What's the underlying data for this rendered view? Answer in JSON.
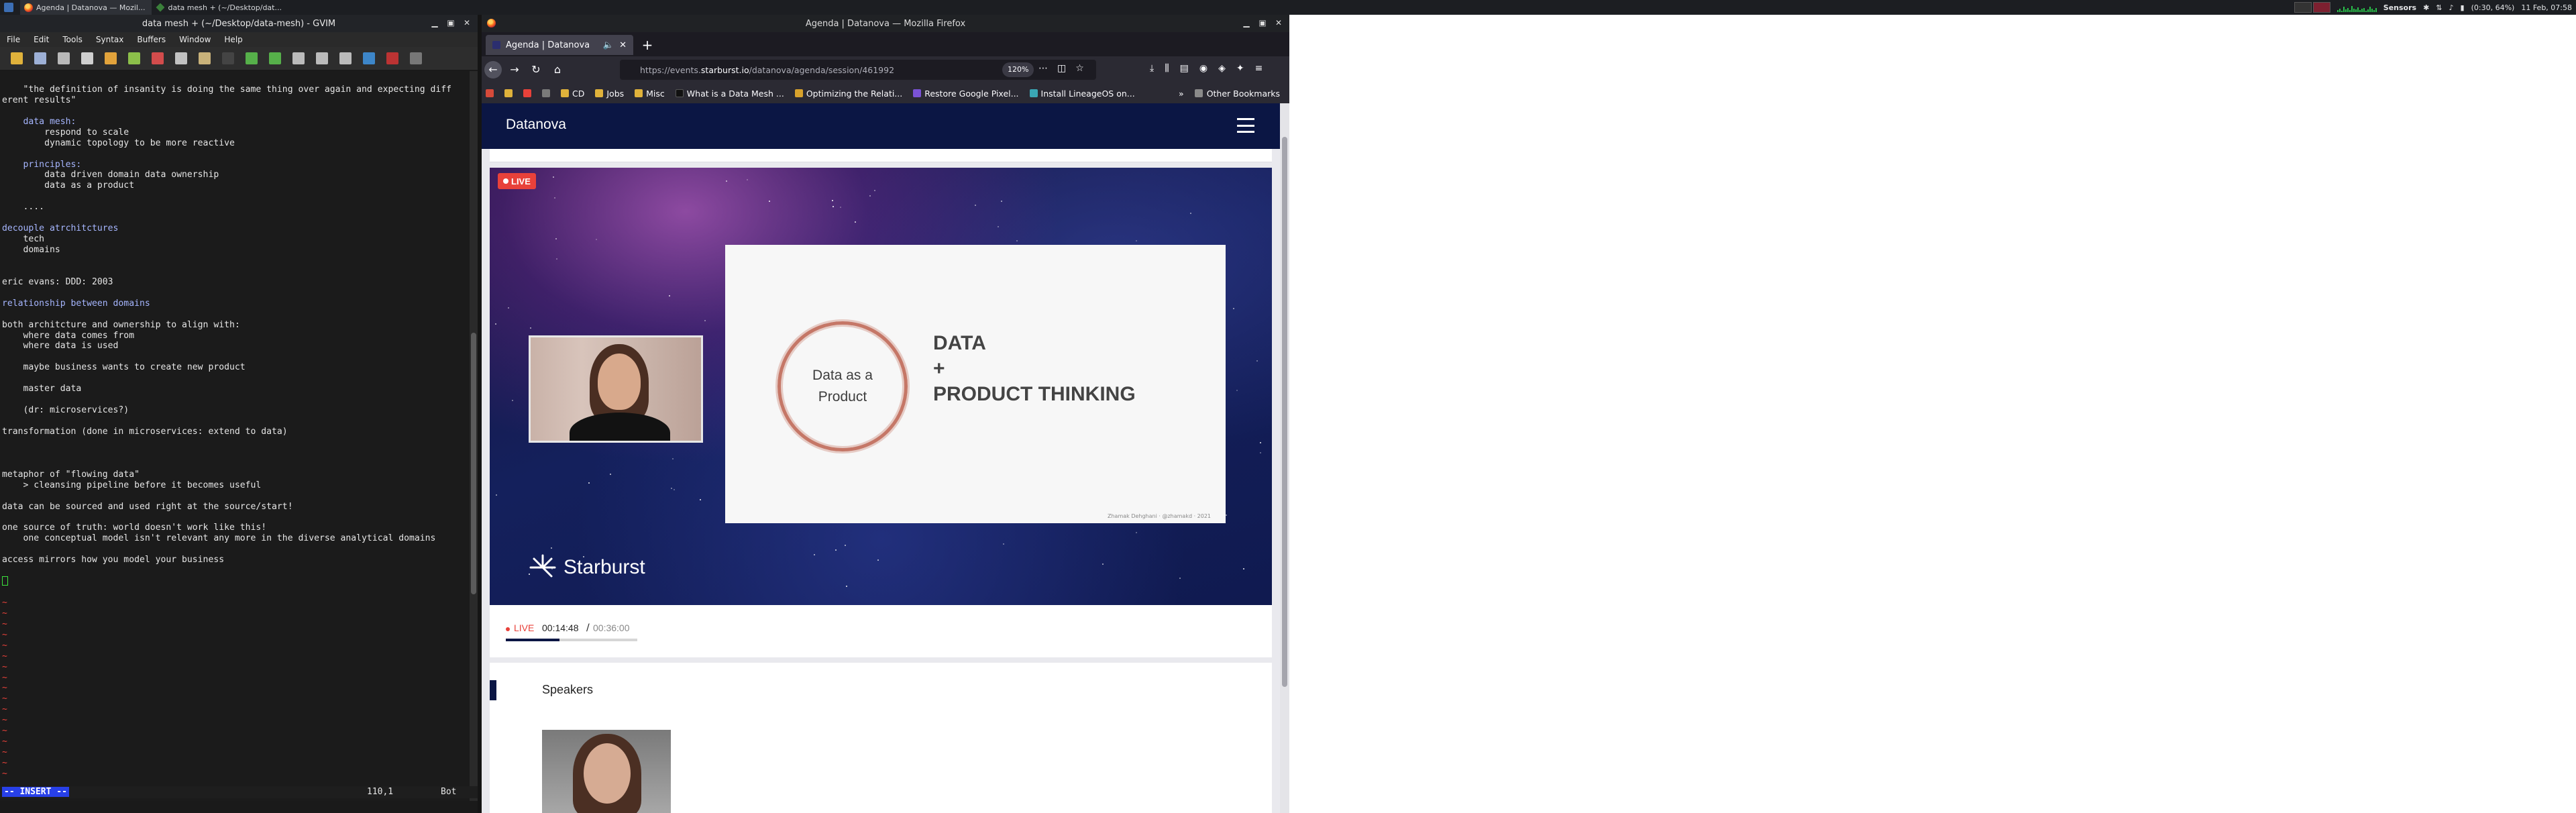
{
  "panel": {
    "tasks": [
      {
        "label": "Agenda | Datanova — Mozil..."
      },
      {
        "label": "data mesh + (~/Desktop/dat..."
      }
    ],
    "tray": {
      "sensors": "Sensors",
      "battery": "(0:30, 64%)",
      "clock": "11 Feb, 07:58"
    }
  },
  "gvim": {
    "title": "data mesh + (~/Desktop/data-mesh) - GVIM",
    "menu": [
      "File",
      "Edit",
      "Tools",
      "Syntax",
      "Buffers",
      "Window",
      "Help"
    ],
    "lines": [
      {
        "t": "",
        "c": ""
      },
      {
        "t": "    \"the definition of insanity is doing the same thing over again and expecting diff",
        "c": ""
      },
      {
        "t": "erent results\"",
        "c": ""
      },
      {
        "t": "",
        "c": ""
      },
      {
        "t": "    data mesh:",
        "c": "blue"
      },
      {
        "t": "        respond to scale",
        "c": ""
      },
      {
        "t": "        dynamic topology to be more reactive",
        "c": ""
      },
      {
        "t": "",
        "c": ""
      },
      {
        "t": "    principles:",
        "c": "blue"
      },
      {
        "t": "        data driven domain data ownership",
        "c": ""
      },
      {
        "t": "        data as a product",
        "c": ""
      },
      {
        "t": "",
        "c": ""
      },
      {
        "t": "    ....",
        "c": ""
      },
      {
        "t": "",
        "c": ""
      },
      {
        "t": "decouple atrchitctures",
        "c": "blue"
      },
      {
        "t": "    tech",
        "c": ""
      },
      {
        "t": "    domains",
        "c": ""
      },
      {
        "t": "",
        "c": ""
      },
      {
        "t": "",
        "c": ""
      },
      {
        "t": "eric evans: DDD: 2003",
        "c": ""
      },
      {
        "t": "",
        "c": ""
      },
      {
        "t": "relationship between domains",
        "c": "blue"
      },
      {
        "t": "",
        "c": ""
      },
      {
        "t": "both architcture and ownership to align with:",
        "c": ""
      },
      {
        "t": "    where data comes from",
        "c": ""
      },
      {
        "t": "    where data is used",
        "c": ""
      },
      {
        "t": "",
        "c": ""
      },
      {
        "t": "    maybe business wants to create new product",
        "c": ""
      },
      {
        "t": "",
        "c": ""
      },
      {
        "t": "    master data",
        "c": ""
      },
      {
        "t": "",
        "c": ""
      },
      {
        "t": "    (dr: microservices?)",
        "c": ""
      },
      {
        "t": "",
        "c": ""
      },
      {
        "t": "transformation (done in microservices: extend to data)",
        "c": ""
      },
      {
        "t": "",
        "c": ""
      },
      {
        "t": "",
        "c": ""
      },
      {
        "t": "",
        "c": ""
      },
      {
        "t": "metaphor of \"flowing data\"",
        "c": ""
      },
      {
        "t": "    > cleansing pipeline before it becomes useful",
        "c": ""
      },
      {
        "t": "",
        "c": ""
      },
      {
        "t": "data can be sourced and used right at the source/start!",
        "c": ""
      },
      {
        "t": "",
        "c": ""
      },
      {
        "t": "one source of truth: world doesn't work like this!",
        "c": ""
      },
      {
        "t": "    one conceptual model isn't relevant any more in the diverse analytical domains",
        "c": ""
      },
      {
        "t": "",
        "c": ""
      },
      {
        "t": "access mirrors how you model your business",
        "c": ""
      },
      {
        "t": "",
        "c": ""
      },
      {
        "t": "",
        "c": "cursor"
      },
      {
        "t": "",
        "c": ""
      },
      {
        "t": "~",
        "c": "tilde"
      },
      {
        "t": "~",
        "c": "tilde"
      },
      {
        "t": "~",
        "c": "tilde"
      },
      {
        "t": "~",
        "c": "tilde"
      },
      {
        "t": "~",
        "c": "tilde"
      },
      {
        "t": "~",
        "c": "tilde"
      },
      {
        "t": "~",
        "c": "tilde"
      },
      {
        "t": "~",
        "c": "tilde"
      },
      {
        "t": "~",
        "c": "tilde"
      },
      {
        "t": "~",
        "c": "tilde"
      },
      {
        "t": "~",
        "c": "tilde"
      },
      {
        "t": "~",
        "c": "tilde"
      },
      {
        "t": "~",
        "c": "tilde"
      },
      {
        "t": "~",
        "c": "tilde"
      },
      {
        "t": "~",
        "c": "tilde"
      },
      {
        "t": "~",
        "c": "tilde"
      },
      {
        "t": "~",
        "c": "tilde"
      }
    ],
    "status": {
      "mode": "-- INSERT --",
      "position": "110,1",
      "scroll": "Bot"
    }
  },
  "firefox": {
    "title": "Agenda | Datanova — Mozilla Firefox",
    "tab": {
      "label": "Agenda | Datanova"
    },
    "url": {
      "prefix": "https://events.",
      "domain": "starburst.io",
      "path": "/datanova/agenda/session/461992"
    },
    "zoom": "120%",
    "bookmarks": [
      {
        "label": "CD",
        "color": "#e0b23b"
      },
      {
        "label": "Jobs",
        "color": "#e0b23b"
      },
      {
        "label": "Misc",
        "color": "#e0b23b"
      },
      {
        "label": "What is a Data Mesh ...",
        "color": "#1f1f1f"
      },
      {
        "label": "Optimizing the Relati...",
        "color": "#d8a22c"
      },
      {
        "label": "Restore Google Pixel...",
        "color": "#7a52d6"
      },
      {
        "label": "Install LineageOS on...",
        "color": "#3aa7b5"
      }
    ],
    "other_bookmarks": "Other Bookmarks"
  },
  "page": {
    "site_name": "Datanova",
    "video": {
      "live_badge": "LIVE",
      "slide": {
        "circle_text_1": "Data as a",
        "circle_text_2": "Product",
        "heading_1": "DATA",
        "plus": "+",
        "heading_2": "PRODUCT THINKING",
        "credit": "Zhamak Dehghani · @zhamakd · 2021"
      },
      "brand": "Starburst"
    },
    "player": {
      "live": "LIVE",
      "current": "00:14:48",
      "separator": "/",
      "duration": "00:36:00",
      "progress": 0.41
    },
    "speakers_title": "Speakers"
  }
}
